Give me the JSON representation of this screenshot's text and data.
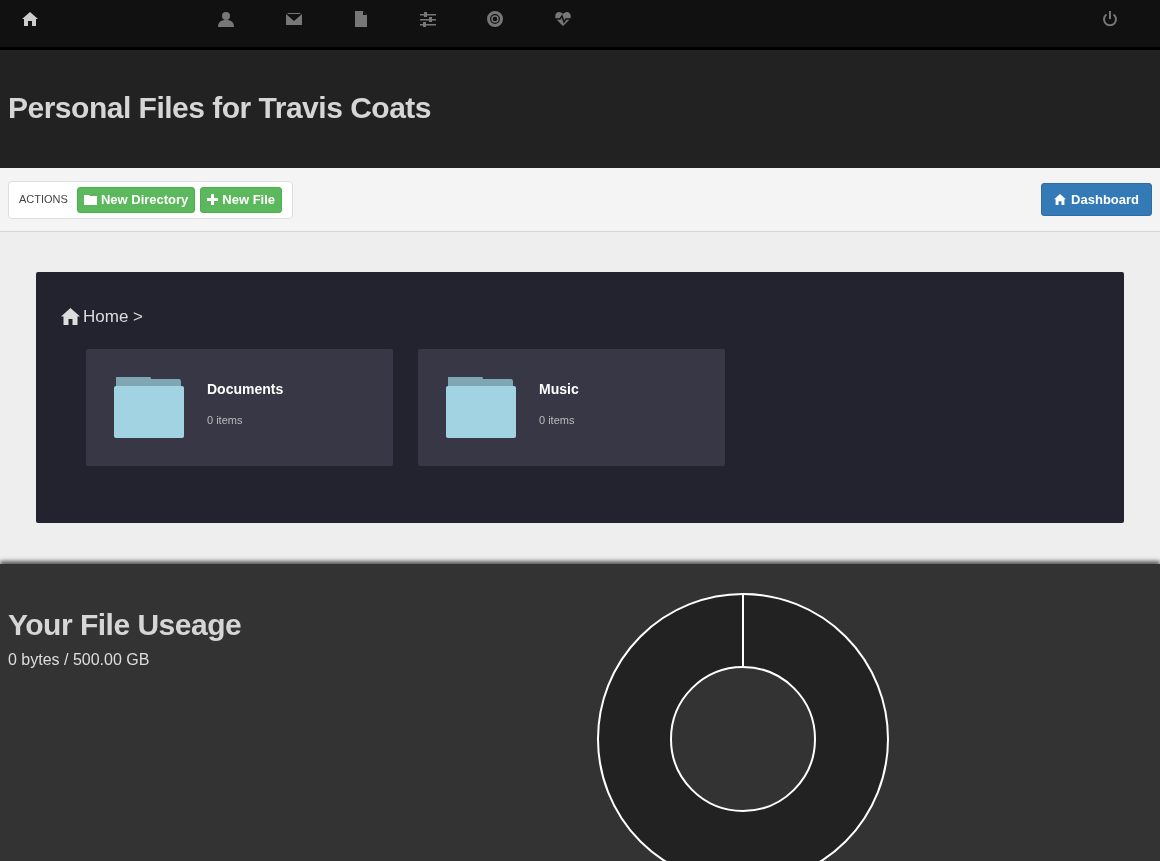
{
  "nav": [
    {
      "kind": "home",
      "selected": true
    },
    {
      "kind": "user",
      "selected": false
    },
    {
      "kind": "mail",
      "selected": false
    },
    {
      "kind": "file",
      "selected": false
    },
    {
      "kind": "sliders",
      "selected": false
    },
    {
      "kind": "lifering",
      "selected": false
    },
    {
      "kind": "heartbeat",
      "selected": false
    },
    {
      "kind": "power",
      "selected": false
    }
  ],
  "title": "Personal Files for Travis Coats",
  "toolbar": {
    "label": "ACTIONS",
    "buttons": [
      {
        "kind": "folder",
        "label": "New Directory"
      },
      {
        "kind": "plus",
        "label": "New File"
      }
    ],
    "dashboard": "Dashboard"
  },
  "breadcrumb": "Home >",
  "folders": [
    {
      "name": "Documents",
      "count": "0 items"
    },
    {
      "name": "Music",
      "count": "0 items"
    }
  ],
  "usage": {
    "title": "Your File Useage",
    "summary": "0 bytes / 500.00 GB"
  }
}
